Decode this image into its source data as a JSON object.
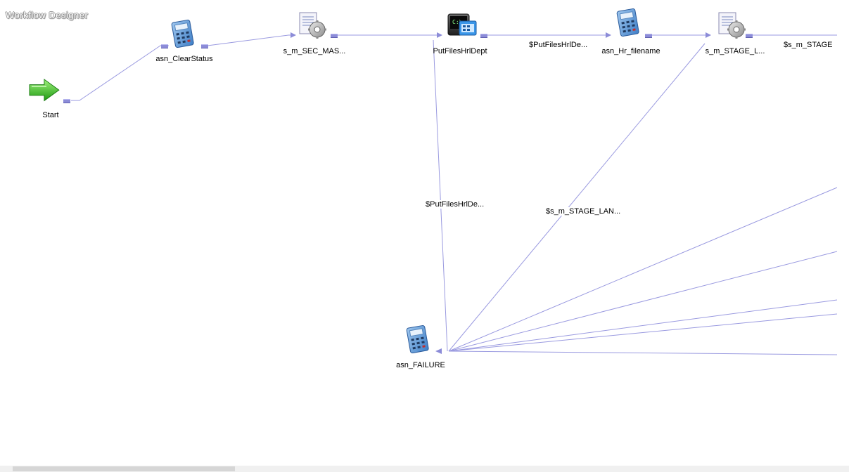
{
  "window": {
    "title": "Workflow Designer"
  },
  "nodes": {
    "start": "Start",
    "clear_status": "asn_ClearStatus",
    "sec_mas": "s_m_SEC_MAS...",
    "put_files": "PutFilesHrlDept",
    "hr_filename": "asn_Hr_filename",
    "stage_l": "s_m_STAGE_L...",
    "failure": "asn_FAILURE"
  },
  "links": {
    "put_files_to_hr": "$PutFilesHrlDe...",
    "stage_out": "$s_m_STAGE",
    "put_files_fail": "$PutFilesHrlDe...",
    "stage_fail": "$s_m_STAGE_LAN..."
  },
  "icons": {
    "start": "start-arrow-icon",
    "assignment": "assignment-calculator-icon",
    "session": "session-gear-icon",
    "command": "command-task-icon"
  },
  "colors": {
    "link": "#9a9ae0",
    "port": "#8c8cd8",
    "start_green": "#3cbc2c"
  }
}
